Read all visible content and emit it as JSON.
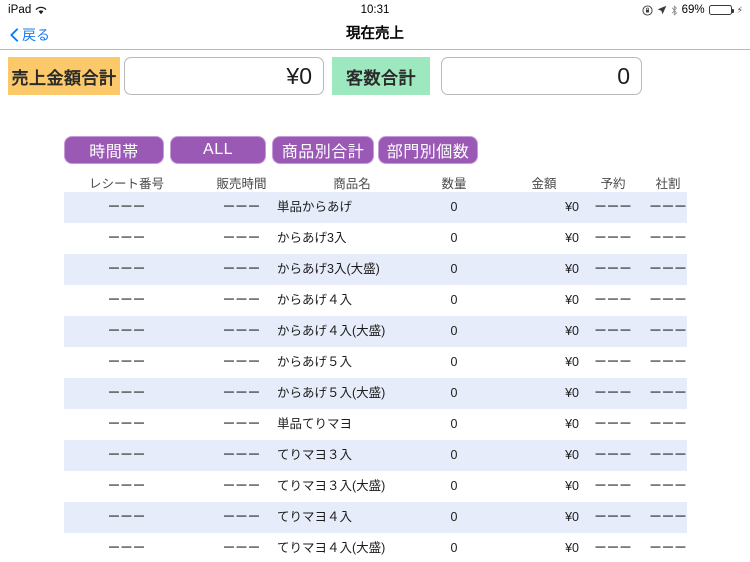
{
  "status_bar": {
    "carrier": "iPad",
    "wifi_icon": "wifi-icon",
    "time": "10:31",
    "rotation_lock_icon": "rotation-lock-icon",
    "location_icon": "location-arrow-icon",
    "bluetooth_icon": "bluetooth-icon",
    "battery_percent": "69%",
    "battery_level": 69,
    "charging_icon": "charging-bolt-icon"
  },
  "nav": {
    "back_label": "戻る",
    "back_icon": "chevron-left-icon",
    "title": "現在売上"
  },
  "totals": {
    "sales_label": "売上金額合計",
    "sales_value": "¥0",
    "sales_label_color": "#fbc96a",
    "guests_label": "客数合計",
    "guests_value": "0",
    "guests_label_color": "#9ee8bf"
  },
  "tabs": {
    "accent_color": "#9b59b6",
    "items": [
      {
        "label": "時間帯"
      },
      {
        "label": "ALL"
      },
      {
        "label": "商品別合計"
      },
      {
        "label": "部門別個数"
      }
    ]
  },
  "table": {
    "columns": [
      {
        "key": "receipt",
        "label": "レシート番号"
      },
      {
        "key": "time",
        "label": "販売時間"
      },
      {
        "key": "name",
        "label": "商品名"
      },
      {
        "key": "qty",
        "label": "数量"
      },
      {
        "key": "amount",
        "label": "金額"
      },
      {
        "key": "reserve",
        "label": "予約"
      },
      {
        "key": "discount",
        "label": "社割"
      }
    ],
    "row_alt_color": "#e6ecfa",
    "rows": [
      {
        "receipt": "ーーー",
        "time": "ーーー",
        "name": "単品からあげ",
        "qty": "0",
        "amount": "¥0",
        "reserve": "ーーー",
        "discount": "ーーー"
      },
      {
        "receipt": "ーーー",
        "time": "ーーー",
        "name": "からあげ3入",
        "qty": "0",
        "amount": "¥0",
        "reserve": "ーーー",
        "discount": "ーーー"
      },
      {
        "receipt": "ーーー",
        "time": "ーーー",
        "name": "からあげ3入(大盛)",
        "qty": "0",
        "amount": "¥0",
        "reserve": "ーーー",
        "discount": "ーーー"
      },
      {
        "receipt": "ーーー",
        "time": "ーーー",
        "name": "からあげ４入",
        "qty": "0",
        "amount": "¥0",
        "reserve": "ーーー",
        "discount": "ーーー"
      },
      {
        "receipt": "ーーー",
        "time": "ーーー",
        "name": "からあげ４入(大盛)",
        "qty": "0",
        "amount": "¥0",
        "reserve": "ーーー",
        "discount": "ーーー"
      },
      {
        "receipt": "ーーー",
        "time": "ーーー",
        "name": "からあげ５入",
        "qty": "0",
        "amount": "¥0",
        "reserve": "ーーー",
        "discount": "ーーー"
      },
      {
        "receipt": "ーーー",
        "time": "ーーー",
        "name": "からあげ５入(大盛)",
        "qty": "0",
        "amount": "¥0",
        "reserve": "ーーー",
        "discount": "ーーー"
      },
      {
        "receipt": "ーーー",
        "time": "ーーー",
        "name": "単品てりマヨ",
        "qty": "0",
        "amount": "¥0",
        "reserve": "ーーー",
        "discount": "ーーー"
      },
      {
        "receipt": "ーーー",
        "time": "ーーー",
        "name": "てりマヨ３入",
        "qty": "0",
        "amount": "¥0",
        "reserve": "ーーー",
        "discount": "ーーー"
      },
      {
        "receipt": "ーーー",
        "time": "ーーー",
        "name": "てりマヨ３入(大盛)",
        "qty": "0",
        "amount": "¥0",
        "reserve": "ーーー",
        "discount": "ーーー"
      },
      {
        "receipt": "ーーー",
        "time": "ーーー",
        "name": "てりマヨ４入",
        "qty": "0",
        "amount": "¥0",
        "reserve": "ーーー",
        "discount": "ーーー"
      },
      {
        "receipt": "ーーー",
        "time": "ーーー",
        "name": "てりマヨ４入(大盛)",
        "qty": "0",
        "amount": "¥0",
        "reserve": "ーーー",
        "discount": "ーーー"
      }
    ]
  }
}
